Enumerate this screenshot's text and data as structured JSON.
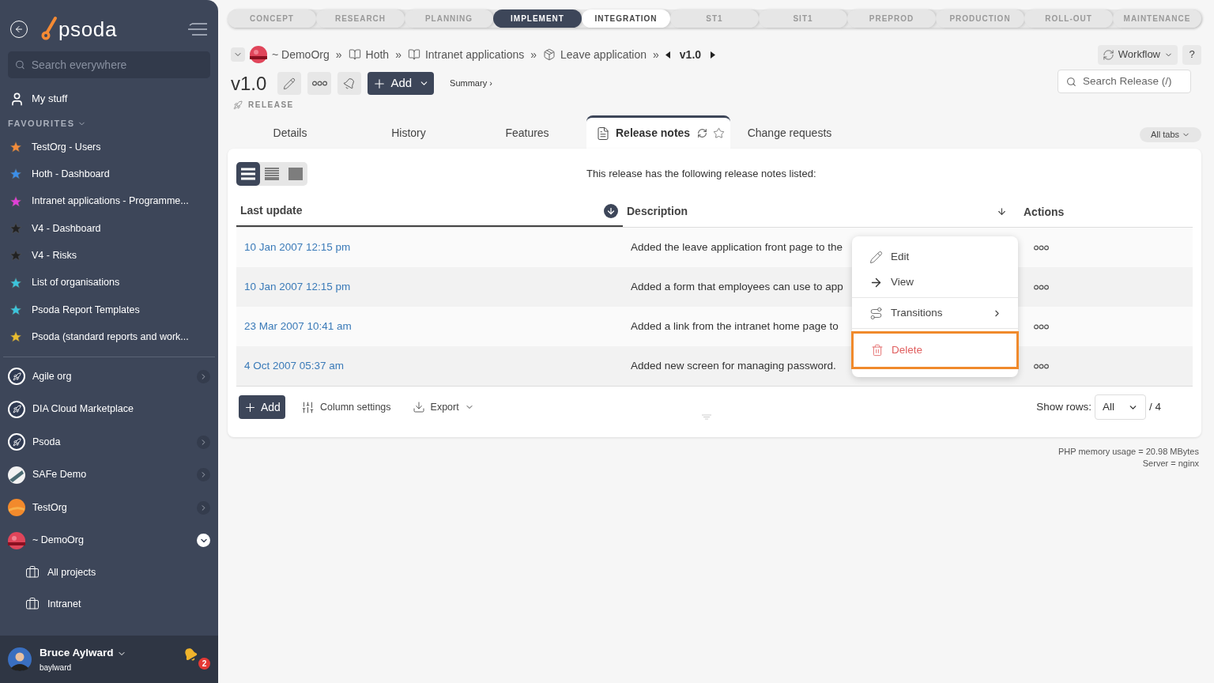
{
  "sidebar": {
    "logo": "psoda",
    "search": {
      "placeholder": "Search everywhere"
    },
    "my_stuff": "My stuff",
    "favourites_heading": "FAVOURITES",
    "favourites": [
      {
        "label": "TestOrg - Users",
        "color": "#f28c3c"
      },
      {
        "label": "Hoth - Dashboard",
        "color": "#3b8ee8"
      },
      {
        "label": "Intranet applications - Programme...",
        "color": "#e040d8"
      },
      {
        "label": "V4 - Dashboard",
        "color": "#222222"
      },
      {
        "label": "V4 - Risks",
        "color": "#222222"
      },
      {
        "label": "List of organisations",
        "color": "#3cc4dc"
      },
      {
        "label": "Psoda Report Templates",
        "color": "#3cc4dc"
      },
      {
        "label": "Psoda (standard reports and work...",
        "color": "#e8bc30"
      }
    ],
    "organisations": [
      {
        "label": "Agile org",
        "kind": "rocket",
        "expanded": false
      },
      {
        "label": "DIA Cloud Marketplace",
        "kind": "rocket"
      },
      {
        "label": "Psoda",
        "kind": "rocket",
        "expanded": false
      },
      {
        "label": "SAFe Demo",
        "kind": "stripes",
        "expanded": false
      },
      {
        "label": "TestOrg",
        "kind": "sun",
        "expanded": false
      },
      {
        "label": "~ DemoOrg",
        "kind": "sunset",
        "expanded": true,
        "children": [
          {
            "label": "All projects"
          },
          {
            "label": "Intranet"
          }
        ]
      }
    ],
    "user": {
      "name": "Bruce Aylward",
      "username": "baylward",
      "notifications": "2"
    }
  },
  "stages": [
    {
      "label": "CONCEPT",
      "selected": false,
      "highlighted": false
    },
    {
      "label": "RESEARCH",
      "selected": false,
      "highlighted": false
    },
    {
      "label": "PLANNING",
      "selected": false,
      "highlighted": false
    },
    {
      "label": "IMPLEMENT",
      "selected": true,
      "highlighted": false
    },
    {
      "label": "INTEGRATION",
      "selected": false,
      "highlighted": true
    },
    {
      "label": "ST1",
      "selected": false,
      "highlighted": false
    },
    {
      "label": "SIT1",
      "selected": false,
      "highlighted": false
    },
    {
      "label": "PREPROD",
      "selected": false,
      "highlighted": false
    },
    {
      "label": "PRODUCTION",
      "selected": false,
      "highlighted": false
    },
    {
      "label": "ROLL-OUT",
      "selected": false,
      "highlighted": false
    },
    {
      "label": "MAINTENANCE",
      "selected": false,
      "highlighted": false
    }
  ],
  "breadcrumb": {
    "separator": "»",
    "items": [
      {
        "label": "~ DemoOrg",
        "kind": "org"
      },
      {
        "label": "Hoth",
        "kind": "book"
      },
      {
        "label": "Intranet applications",
        "kind": "book"
      },
      {
        "label": "Leave application",
        "kind": "package"
      }
    ],
    "current": "v1.0"
  },
  "header": {
    "title": "v1.0",
    "type": "RELEASE",
    "add_button": "Add",
    "summary_link": "Summary ›",
    "workflow_button": "Workflow",
    "help_button": "?",
    "search": {
      "placeholder": "Search Release (/)"
    }
  },
  "tabs": [
    {
      "label": "Details",
      "selected": false
    },
    {
      "label": "History",
      "selected": false
    },
    {
      "label": "Features",
      "selected": false
    },
    {
      "label": "Release notes",
      "selected": true
    },
    {
      "label": "Change requests",
      "selected": false
    }
  ],
  "all_tabs_button": "All tabs",
  "density": [
    {
      "selected": true
    },
    {
      "selected": false
    },
    {
      "selected": false
    }
  ],
  "intro": "This release has the following release notes listed:",
  "table": {
    "columns": [
      "Last update",
      "Description",
      "Actions"
    ],
    "rows": [
      {
        "last_update": "10 Jan 2007 12:15 pm",
        "description": "Added the leave application front page to the"
      },
      {
        "last_update": "10 Jan 2007 12:15 pm",
        "description": "Added a form that employees can use to app"
      },
      {
        "last_update": "23 Mar 2007 10:41 am",
        "description": "Added a link from the intranet home page to"
      },
      {
        "last_update": "4 Oct 2007 05:37 am",
        "description": "Added new screen for managing password."
      }
    ]
  },
  "context_menu": [
    {
      "label": "Edit",
      "kind": "edit",
      "highlighted": false
    },
    {
      "label": "View",
      "kind": "view",
      "highlighted": false
    },
    {
      "label": "Transitions",
      "kind": "submenu",
      "highlighted": false
    },
    {
      "label": "Delete",
      "kind": "danger",
      "highlighted": true
    }
  ],
  "footer": {
    "add_button": "Add",
    "column_settings": "Column settings",
    "export": "Export",
    "show_rows_label": "Show rows:",
    "show_rows_value": "All",
    "total": "/ 4"
  },
  "server_info": [
    "PHP memory usage = 20.98 MBytes",
    "Server = nginx"
  ]
}
